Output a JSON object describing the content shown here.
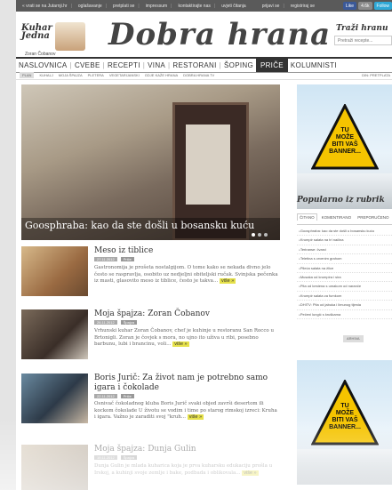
{
  "topbar": {
    "links": [
      "« vrati se na Jutarnji.hr",
      "oglašavanje",
      "pretplati se",
      "impressum",
      "kontaktirajte nas",
      "uvjeti čitanja"
    ],
    "right_links": [
      "prijavi se",
      "registriraj se"
    ],
    "social": [
      "Like",
      "4.6k",
      "Follow"
    ]
  },
  "header": {
    "logo_small": "Kuhar\nJedna",
    "chef_name": "Zoran Čobanov",
    "site_title": "Dobra hrana",
    "search_label": "Traži hranu",
    "search_placeholder": "Pretraži recepte..."
  },
  "nav": {
    "items": [
      "NASLOVNICA",
      "CVEBE",
      "RECEPTI",
      "VINA",
      "RESTORANI",
      "ŠOPING",
      "PRIČE",
      "KOLUMNISTI"
    ],
    "active": "PRIČE"
  },
  "subnav": {
    "items": [
      "PLAN",
      "KUHALJ",
      "MOJA ŠPAJZA",
      "PLETERA",
      "VEGETARIJANSKI",
      "GDJE KAŽE HRANA",
      "DOBRA HRANA TV"
    ],
    "date": "DIN: PRETPLATA"
  },
  "hero": {
    "title": "Goosphraba: kao da ste došli u bosansku kuću",
    "slides": 3,
    "active_slide": 1
  },
  "articles": [
    {
      "title": "Meso iz tiblice",
      "date": "27.11.2012",
      "tag": "Priče",
      "text": "Gastronomija je prošeta nostalgijom. O tome kako se nekada divno jelo često se raspravlja, osobito uz nedjeljni obiteljski ručak. Svinjska pečenka iz masti, glasovito meso iz tiblice, često je takva...",
      "more": "više »"
    },
    {
      "title": "Moja špajza: Zoran Čobanov",
      "date": "26.11.2012",
      "tag": "Špajza",
      "text": "Vrhunski kuhar Zoran Čobanov, chef je kuhinje u restoranu San Rocco u Brtonigli. Zoran je čovjek s mora, no ujno ito uživa u ribi, posebno barbunu, lubi i brancinu, voli...",
      "more": "više »"
    },
    {
      "title": "Boris Jurič: Za život nam je potrebno samo igara i čokolade",
      "date": "22.11.2012",
      "tag": "Priče",
      "text": "Osnivač čokoladnog kluba Boris Jurič svaki objed završi desertom ili kockom čokolade U životu se vodim i time po starog rimskoj izreci: Kruha i igara. Važno je zaraditi svoj \"kruh...",
      "more": "više »"
    },
    {
      "title": "Moja špajza: Dunja Gulin",
      "date": "19.11.2012",
      "tag": "Špajza",
      "text": "Dunja Gulin je mlada kuharica koja je prva kuharsku edukaciju prošla u Irskoj, a kuhinji svoje zemlje i bake, podbada i oblikovala...",
      "more": "više »"
    }
  ],
  "ads": [
    {
      "line1": "TU",
      "line2": "MOŽE",
      "line3": "BITI VAŠ",
      "line4": "BANNER..."
    },
    {
      "line1": "TU",
      "line2": "MOŽE",
      "line3": "BITI VAŠ",
      "line4": "BANNER..."
    }
  ],
  "rubric": {
    "title": "Popularno iz rubrik",
    "tabs": [
      "ČITANO",
      "KOMENTIRANO",
      "PREPORUČENO"
    ],
    "active_tab": "ČITANO",
    "items": [
      "Goosphraba: kao da ste došli u bosansku kuću",
      "Krumpir salata na tri načina",
      "Teriranse: čvarci",
      "Teletina s crvenim grahom",
      "Pileća salata na žlice",
      "Musaka od krumpira i sira",
      "Pita od kestena s umakom od naranče",
      "Krumpir salata za fumkom",
      "DHITV: Pita od jabuka i limunog tijesta",
      "Pečeni lungić s kruškama"
    ],
    "more": "ARHIVA"
  }
}
